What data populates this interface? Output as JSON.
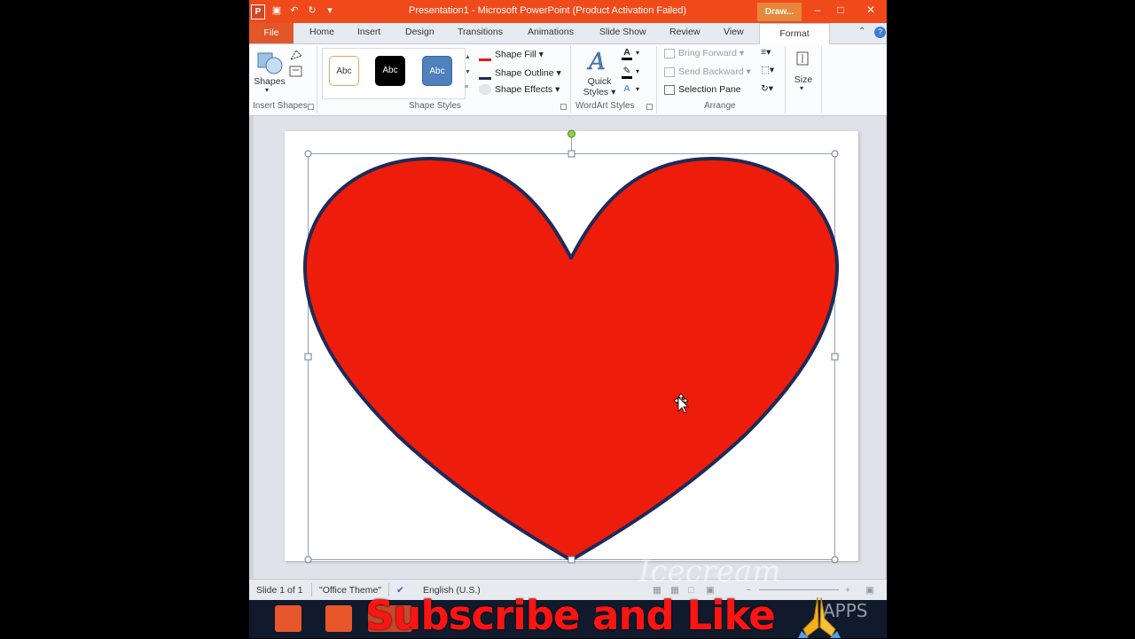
{
  "titlebar": {
    "app_icon": "P",
    "title": "Presentation1  -  Microsoft PowerPoint (Product Activation Failed)",
    "context_tab": "Draw..."
  },
  "tabs": {
    "file": "File",
    "home": "Home",
    "insert": "Insert",
    "design": "Design",
    "transitions": "Transitions",
    "animations": "Animations",
    "slideshow": "Slide Show",
    "review": "Review",
    "view": "View",
    "format": "Format"
  },
  "ribbon": {
    "insert_shapes": {
      "shapes_label": "Shapes",
      "group_label": "Insert Shapes"
    },
    "shape_styles": {
      "swatch1": "Abc",
      "swatch2": "Abc",
      "swatch3": "Abc",
      "shape_fill": "Shape Fill",
      "shape_outline": "Shape Outline",
      "shape_effects": "Shape Effects",
      "group_label": "Shape Styles"
    },
    "wordart": {
      "quick_styles_line1": "Quick",
      "quick_styles_line2": "Styles",
      "group_label": "WordArt Styles"
    },
    "arrange": {
      "bring_forward": "Bring Forward",
      "send_backward": "Send Backward",
      "selection_pane": "Selection Pane",
      "group_label": "Arrange"
    },
    "size": {
      "label": "Size"
    }
  },
  "statusbar": {
    "slide": "Slide 1 of 1",
    "theme": "\"Office Theme\"",
    "language": "English (U.S.)"
  },
  "overlay": {
    "subscribe": "Subscribe and Like",
    "watermark": "Icecream",
    "watermark_apps": "APPS"
  },
  "colors": {
    "heart_fill": "#ee1c0a",
    "heart_outline": "#1f2a58",
    "title_bar": "#f04a1a"
  }
}
